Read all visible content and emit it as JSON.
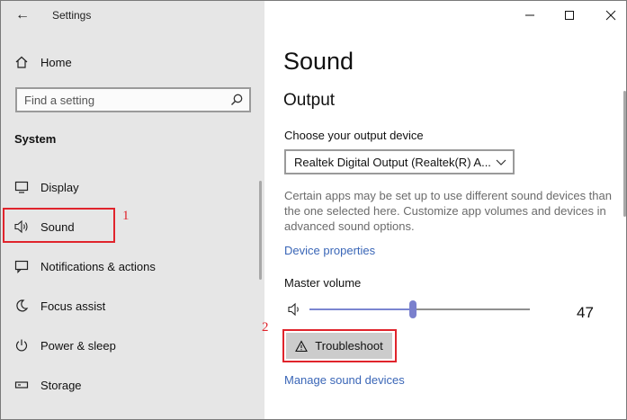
{
  "app": {
    "title": "Settings"
  },
  "sidebar": {
    "home_label": "Home",
    "search_placeholder": "Find a setting",
    "section_label": "System",
    "items": [
      {
        "label": "Display",
        "icon": "display-icon"
      },
      {
        "label": "Sound",
        "icon": "speaker-icon"
      },
      {
        "label": "Notifications & actions",
        "icon": "notification-icon"
      },
      {
        "label": "Focus assist",
        "icon": "moon-icon"
      },
      {
        "label": "Power & sleep",
        "icon": "power-icon"
      },
      {
        "label": "Storage",
        "icon": "storage-icon"
      }
    ]
  },
  "annotations": {
    "step1": "1",
    "step2": "2",
    "color": "#e0242c"
  },
  "main": {
    "title": "Sound",
    "output_heading": "Output",
    "output_device_label": "Choose your output device",
    "output_device_value": "Realtek Digital Output (Realtek(R) A...",
    "description": "Certain apps may be set up to use different sound devices than the one selected here. Customize app volumes and devices in advanced sound options.",
    "device_properties_link": "Device properties",
    "master_volume_label": "Master volume",
    "volume_value": "47",
    "volume_fraction": 0.47,
    "troubleshoot_label": "Troubleshoot",
    "manage_devices_link": "Manage sound devices"
  },
  "colors": {
    "accent": "#3a66b7",
    "slider": "#7b86d1",
    "sidebar_bg": "#e6e6e6"
  }
}
